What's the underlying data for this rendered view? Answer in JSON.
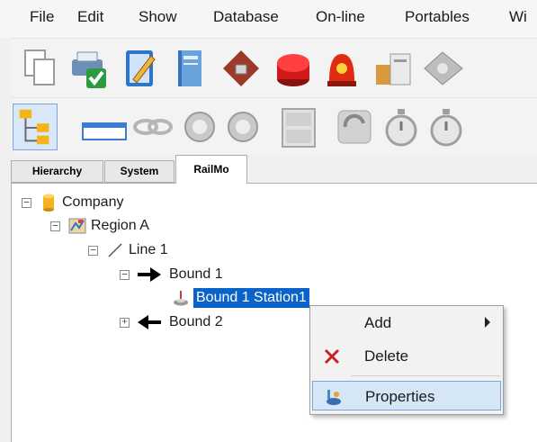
{
  "menu": {
    "items": [
      "File",
      "Edit",
      "Show",
      "Database",
      "On-line",
      "Portables",
      "Wi"
    ]
  },
  "toolbar1": {
    "icons": [
      "copy-icon",
      "print-icon",
      "edit-notebook-icon",
      "book-icon",
      "diamond-clip-icon",
      "red-button-icon",
      "alarm-icon",
      "package-icon",
      "map-icon"
    ]
  },
  "toolbar2": {
    "icons": [
      "hierarchy-icon",
      "panel-icon",
      "link-icon",
      "refresh-icon",
      "refresh-icon",
      "cabinet-icon",
      "cycle-icon",
      "stopwatch-icon",
      "stopwatch-icon"
    ]
  },
  "tabs": [
    "Hierarchy",
    "System",
    "RailMo"
  ],
  "tree": {
    "company": "Company",
    "region": "Region A",
    "line": "Line 1",
    "bound1": "Bound 1",
    "station": "Bound 1 Station1",
    "bound2": "Bound 2"
  },
  "context_menu": {
    "add": "Add",
    "delete": "Delete",
    "properties": "Properties"
  },
  "colors": {
    "selection": "#0a63c9",
    "menu_hover": "#d5e6f7"
  }
}
